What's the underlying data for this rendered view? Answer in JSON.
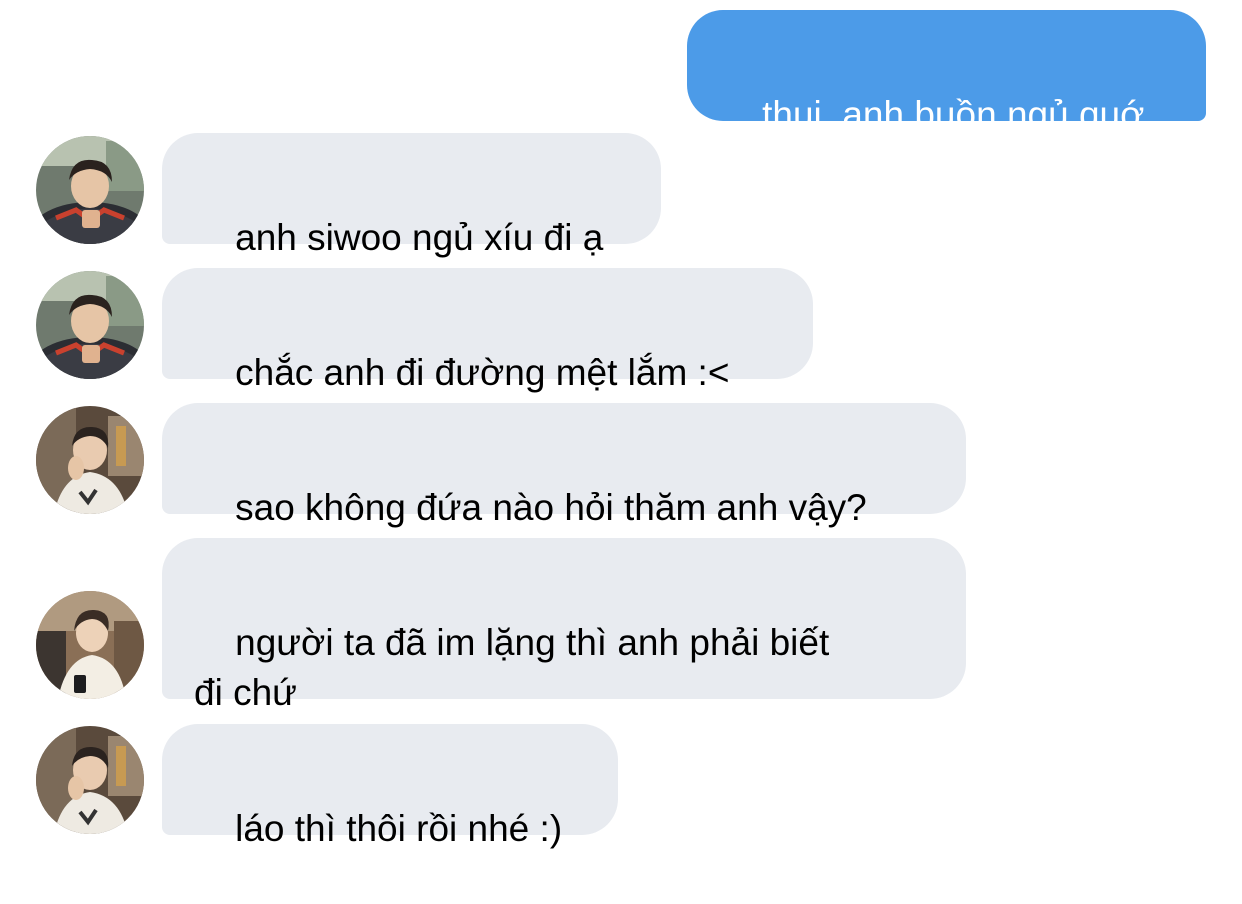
{
  "conversation": {
    "messages": [
      {
        "direction": "outgoing",
        "text": "thui, anh buồn ngủ quớ"
      },
      {
        "direction": "incoming",
        "sender_avatar": "avatar-a",
        "text": "anh siwoo ngủ xíu đi ạ"
      },
      {
        "direction": "incoming",
        "sender_avatar": "avatar-a",
        "text": "chắc anh đi đường mệt lắm :<"
      },
      {
        "direction": "incoming",
        "sender_avatar": "avatar-b",
        "text": "sao không đứa nào hỏi thăm anh vậy?"
      },
      {
        "direction": "incoming",
        "sender_avatar": "avatar-c",
        "text": "người ta đã im lặng thì anh phải biết\nđi chứ"
      },
      {
        "direction": "incoming",
        "sender_avatar": "avatar-b",
        "text": "láo thì thôi rồi nhé :)"
      }
    ]
  },
  "colors": {
    "outgoing_bubble": "#4c9be8",
    "incoming_bubble": "#e8ebf0",
    "outgoing_text": "#ffffff",
    "incoming_text": "#000000"
  }
}
